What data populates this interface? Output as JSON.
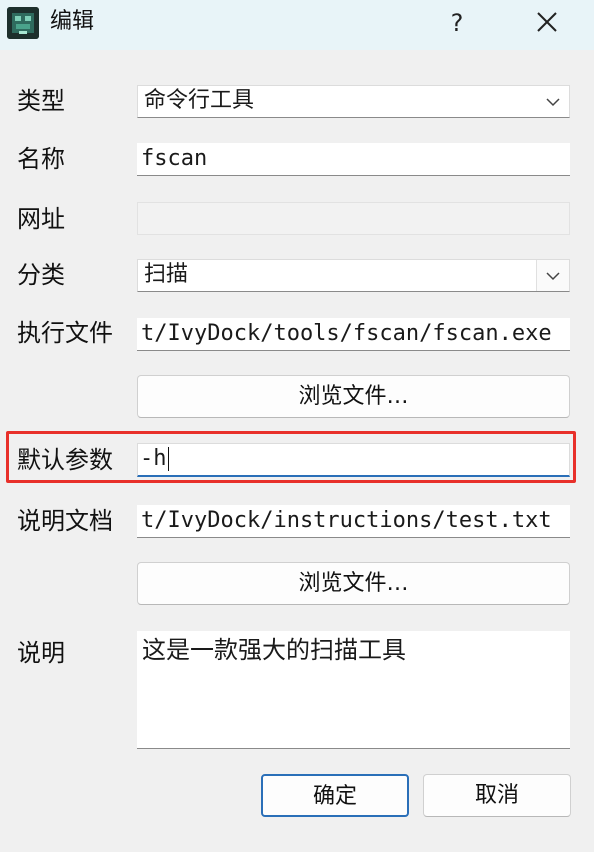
{
  "window": {
    "title": "编辑",
    "help_label": "?",
    "app_icon": "app-logo-icon",
    "close_icon": "close-icon"
  },
  "form": {
    "type": {
      "label": "类型",
      "value": "命令行工具"
    },
    "name": {
      "label": "名称",
      "value": "fscan"
    },
    "url": {
      "label": "网址",
      "value": ""
    },
    "category": {
      "label": "分类",
      "value": "扫描"
    },
    "exec_file": {
      "label": "执行文件",
      "value": "t/IvyDock/tools/fscan/fscan.exe"
    },
    "browse_exec_label": "浏览文件…",
    "default_params": {
      "label": "默认参数",
      "value": "-h"
    },
    "doc_file": {
      "label": "说明文档",
      "value": "t/IvyDock/instructions/test.txt"
    },
    "browse_doc_label": "浏览文件…",
    "description": {
      "label": "说明",
      "value": "这是一款强大的扫描工具"
    }
  },
  "buttons": {
    "ok_label": "确定",
    "cancel_label": "取消"
  },
  "colors": {
    "highlight": "#e8302a",
    "focus": "#2a6fb8",
    "titlebar": "#e8f4f8"
  }
}
